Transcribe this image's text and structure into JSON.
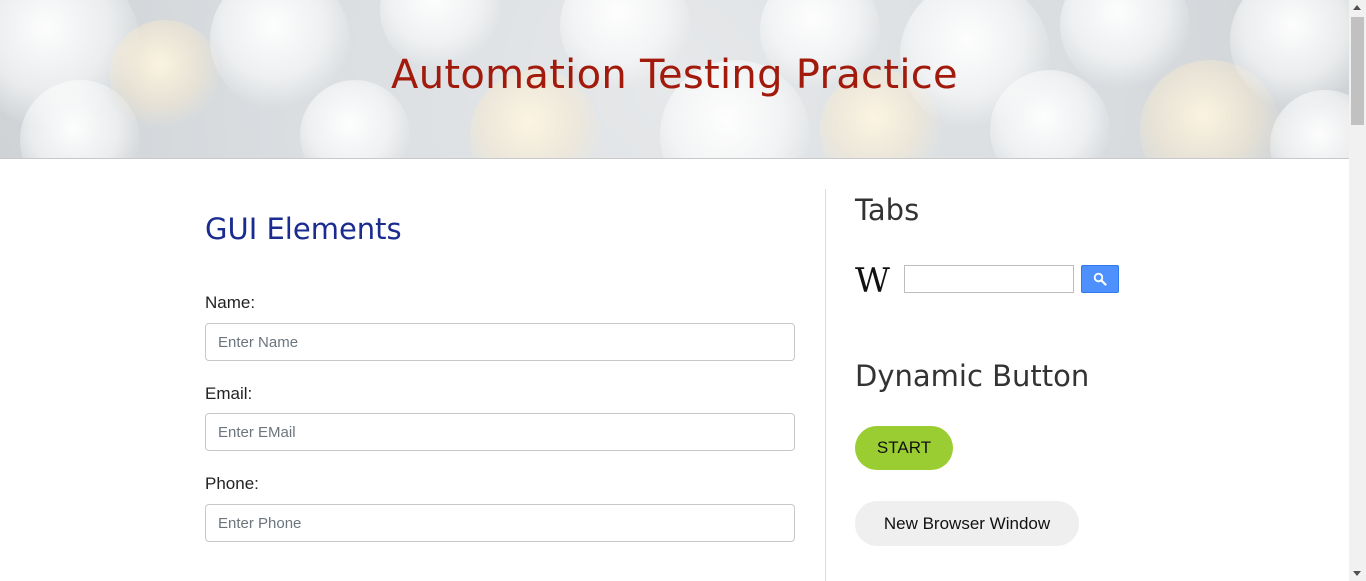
{
  "header": {
    "title": "Automation Testing Practice"
  },
  "gui_section": {
    "title": "GUI Elements",
    "fields": [
      {
        "label": "Name:",
        "placeholder": "Enter Name",
        "value": ""
      },
      {
        "label": "Email:",
        "placeholder": "Enter EMail",
        "value": ""
      },
      {
        "label": "Phone:",
        "placeholder": "Enter Phone",
        "value": ""
      }
    ]
  },
  "sidebar": {
    "tabs_heading": "Tabs",
    "wikipedia": {
      "logo_text": "W",
      "search_value": "",
      "search_icon": "search-icon"
    },
    "dynamic_heading": "Dynamic Button",
    "start_button": "START",
    "new_window_button": "New Browser Window"
  },
  "colors": {
    "title": "#a11a0b",
    "section_title": "#1a2c8f",
    "start_button": "#9acd32",
    "search_button": "#4d90fe"
  }
}
